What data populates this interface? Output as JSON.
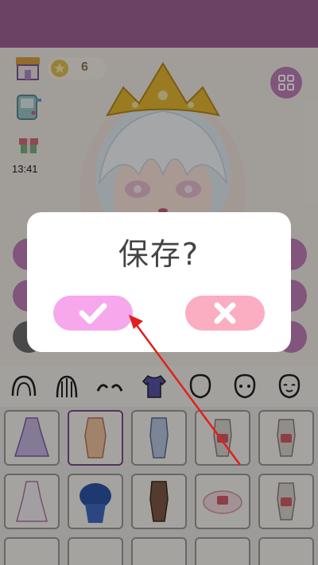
{
  "hud": {
    "coins": "6",
    "time": "13:41"
  },
  "dialog": {
    "title": "保存?",
    "confirm_icon": "check-icon",
    "cancel_icon": "close-icon"
  },
  "categories": [
    "hair-back-icon",
    "hair-front-icon",
    "eyebrows-icon",
    "top-icon",
    "face-shape-icon",
    "face-icon",
    "expression-icon"
  ],
  "colors": {
    "topbar": "#a06396",
    "confirm_button": "#f7a8ec",
    "cancel_button": "#fbadc2",
    "annotation_arrow": "#e0201e"
  }
}
